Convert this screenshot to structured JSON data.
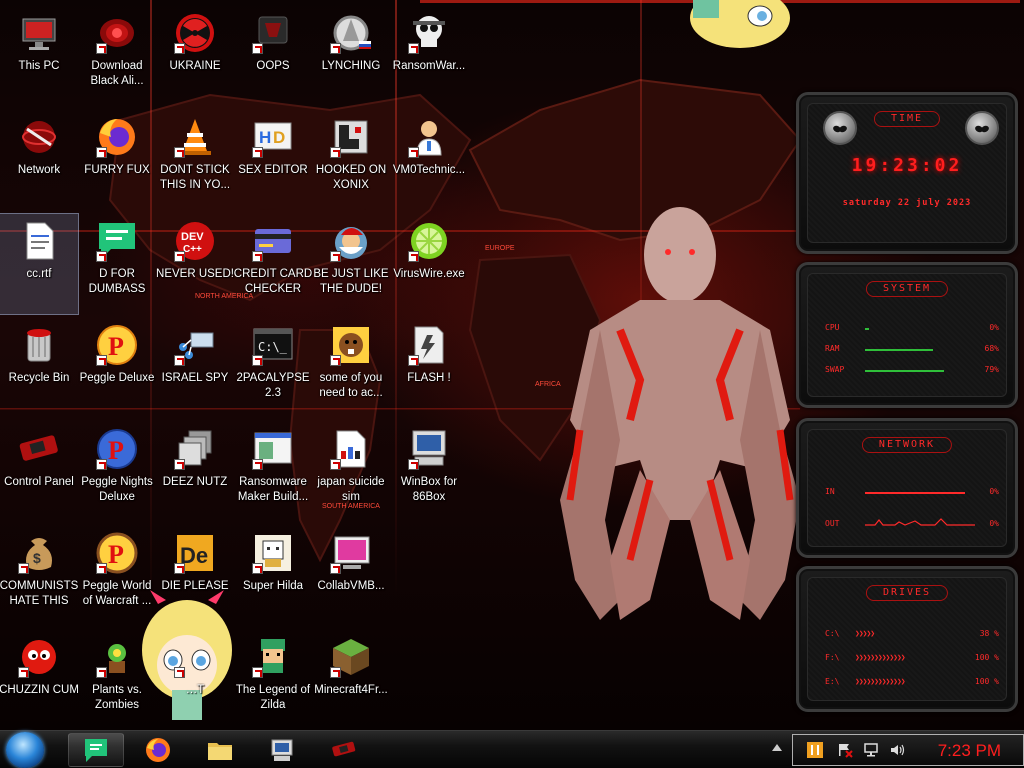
{
  "desktop": {
    "icons": [
      {
        "label": "This PC",
        "icon": "computer-icon"
      },
      {
        "label": "Download Black Ali...",
        "icon": "alien-head-icon"
      },
      {
        "label": "UKRAINE",
        "icon": "radiation-icon"
      },
      {
        "label": "OOPS",
        "icon": "dark-monitor-icon"
      },
      {
        "label": "LYNCHING",
        "icon": "gear-flag-icon"
      },
      {
        "label": "RansomWar...",
        "icon": "skull-icon"
      },
      {
        "label": "Network",
        "icon": "network-icon"
      },
      {
        "label": "FURRY FUX",
        "icon": "firefox-icon"
      },
      {
        "label": "DONT STICK THIS IN YO...",
        "icon": "traffic-cone-icon"
      },
      {
        "label": "SEX EDITOR",
        "icon": "hex-editor-icon"
      },
      {
        "label": "HOOKED ON XONIX",
        "icon": "xonix-icon"
      },
      {
        "label": "VM0Technic...",
        "icon": "doctor-icon"
      },
      {
        "label": "cc.rtf",
        "icon": "document-icon"
      },
      {
        "label": "D FOR DUMBASS",
        "icon": "speech-bubble-icon"
      },
      {
        "label": "NEVER USED!",
        "icon": "devcpp-icon"
      },
      {
        "label": "CREDIT CARD CHECKER",
        "icon": "credit-card-icon"
      },
      {
        "label": "BE JUST LIKE THE DUDE!",
        "icon": "santa-icon"
      },
      {
        "label": "VirusWire.exe",
        "icon": "lime-icon"
      },
      {
        "label": "Recycle Bin",
        "icon": "recycle-bin-icon"
      },
      {
        "label": "Peggle Deluxe",
        "icon": "peggle-icon"
      },
      {
        "label": "ISRAEL SPY",
        "icon": "spy-network-icon"
      },
      {
        "label": "2PACALYPSE 2.3",
        "icon": "terminal-icon"
      },
      {
        "label": "some of you need to ac...",
        "icon": "beaver-icon"
      },
      {
        "label": "FLASH !",
        "icon": "flash-icon"
      },
      {
        "label": "Control Panel",
        "icon": "control-panel-icon"
      },
      {
        "label": "Peggle Nights Deluxe",
        "icon": "peggle-nights-icon"
      },
      {
        "label": "DEEZ NUTZ",
        "icon": "windows-stack-icon"
      },
      {
        "label": "Ransomware Maker Build...",
        "icon": "builder-window-icon"
      },
      {
        "label": "japan suicide sim",
        "icon": "pixel-doc-icon"
      },
      {
        "label": "WinBox for 86Box",
        "icon": "old-pc-icon"
      },
      {
        "label": "COMMUNISTS HATE THIS G...",
        "icon": "money-bag-icon"
      },
      {
        "label": "Peggle World of Warcraft ...",
        "icon": "peggle-wow-icon"
      },
      {
        "label": "DIE PLEASE",
        "icon": "de-icon"
      },
      {
        "label": "Super Hilda",
        "icon": "pixel-hilda-icon"
      },
      {
        "label": "CollabVMB...",
        "icon": "collabvm-icon"
      },
      {
        "label": "CHUZZIN CUM",
        "icon": "chuzzle-icon"
      },
      {
        "label": "Plants vs. Zombies",
        "icon": "plants-icon"
      },
      {
        "label": "…T",
        "icon": "hidden-icon"
      },
      {
        "label": "The Legend of Zilda",
        "icon": "zilda-icon"
      },
      {
        "label": "Minecraft4Fr...",
        "icon": "minecraft-block-icon"
      }
    ]
  },
  "gadgets": {
    "time": {
      "title": "TIME",
      "clock": "19:23:02",
      "date": "saturday 22 july 2023"
    },
    "system": {
      "title": "SYSTEM",
      "rows": [
        {
          "label": "CPU",
          "value": "0%",
          "level": 0.02
        },
        {
          "label": "RAM",
          "value": "68%",
          "level": 0.68
        },
        {
          "label": "SWAP",
          "value": "79%",
          "level": 0.79
        }
      ]
    },
    "network": {
      "title": "NETWORK",
      "rows": [
        {
          "label": "IN",
          "value": "0%"
        },
        {
          "label": "OUT",
          "value": "0%"
        }
      ]
    },
    "drives": {
      "title": "DRIVES",
      "rows": [
        {
          "label": "C:\\",
          "value": "38 %"
        },
        {
          "label": "F:\\",
          "value": "100 %"
        },
        {
          "label": "E:\\",
          "value": "100 %"
        }
      ]
    }
  },
  "wallpaper": {
    "labels": [
      "NORTH AMERICA",
      "SOUTH AMERICA",
      "EUROPE",
      "AFRICA"
    ]
  },
  "taskbar": {
    "pinned": [
      "speech-bubble-icon",
      "firefox-icon",
      "folder-icon",
      "old-pc-icon",
      "alien-console-icon"
    ],
    "clock": "7:23 PM"
  },
  "colors": {
    "accent": "#ff1e1e",
    "panel": "#141414"
  }
}
